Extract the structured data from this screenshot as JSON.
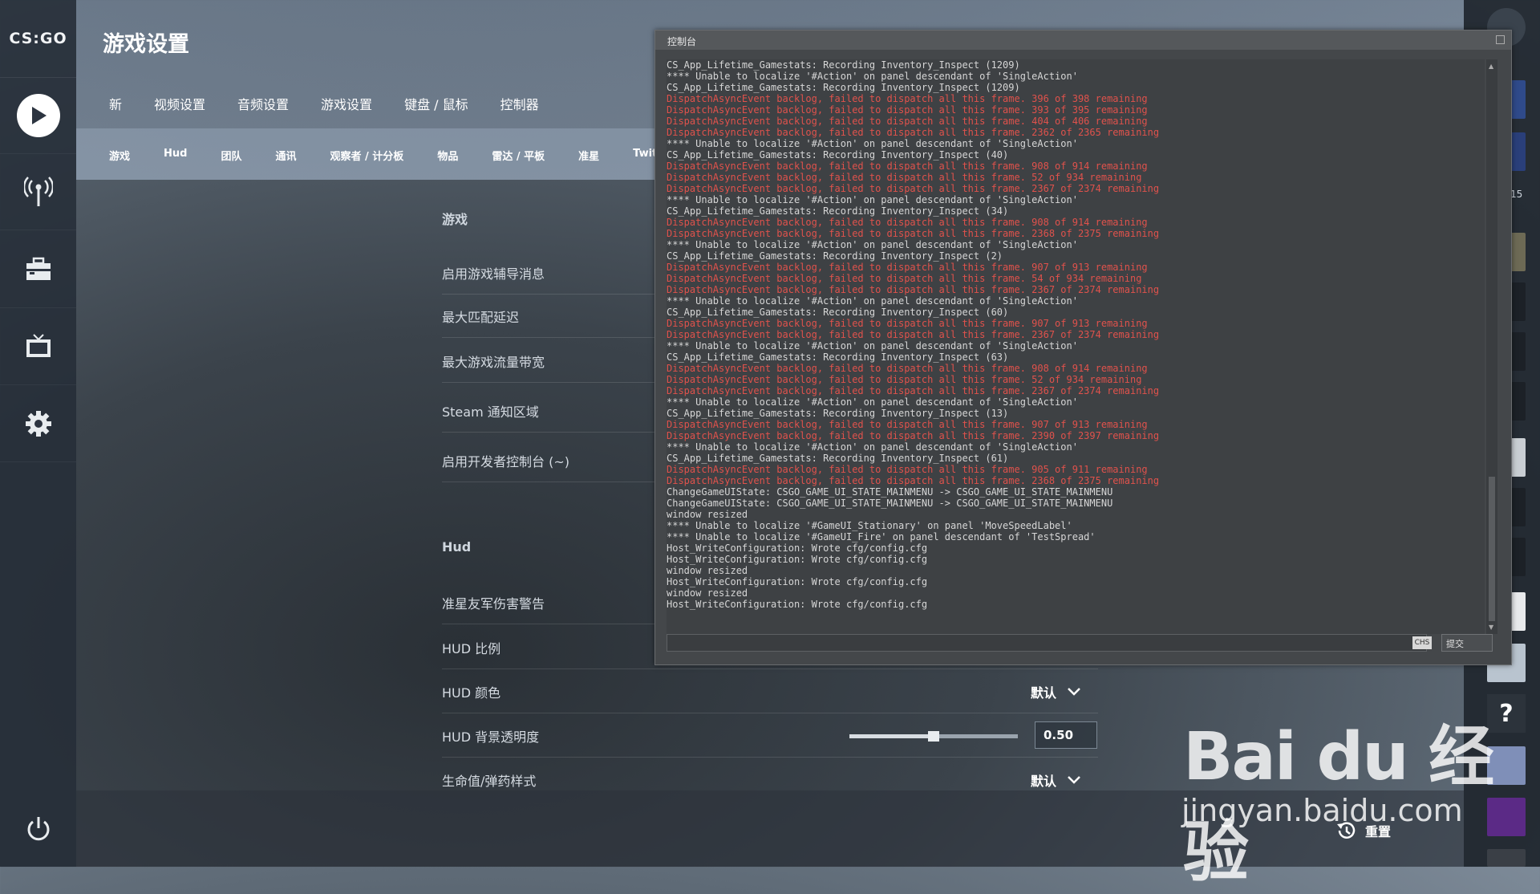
{
  "app": {
    "logo": "CS:GO",
    "title": "游戏设置"
  },
  "tabs": [
    "新",
    "视频设置",
    "音频设置",
    "游戏设置",
    "键盘 / 鼠标",
    "控制器"
  ],
  "subtabs": [
    "游戏",
    "Hud",
    "团队",
    "通讯",
    "观察者 / 计分板",
    "物品",
    "雷达 / 平板",
    "准星",
    "Twitch"
  ],
  "sections": {
    "game": {
      "title": "游戏",
      "rows": [
        "启用游戏辅导消息",
        "最大匹配延迟",
        "最大游戏流量带宽",
        "Steam 通知区域",
        "启用开发者控制台 (~)"
      ]
    },
    "hud": {
      "title": "Hud",
      "rows": {
        "ff_warning": "准星友军伤害警告",
        "hud_scale": "HUD 比例",
        "hud_color": "HUD 颜色",
        "hud_color_value": "默认",
        "hud_bg_alpha": "HUD 背景透明度",
        "hud_bg_alpha_value": "0.50",
        "hud_bg_alpha_fraction": 0.5,
        "health_style": "生命值/弹药样式",
        "health_style_value": "默认"
      }
    }
  },
  "console": {
    "title": "控制台",
    "ime": "CHS",
    "submit": "提交",
    "lines": [
      {
        "t": "CS_App_Lifetime_Gamestats: Recording Inventory_Inspect (1209)",
        "e": false
      },
      {
        "t": "**** Unable to localize '#Action' on panel descendant of 'SingleAction'",
        "e": false
      },
      {
        "t": "CS_App_Lifetime_Gamestats: Recording Inventory_Inspect (1209)",
        "e": false
      },
      {
        "t": "DispatchAsyncEvent backlog, failed to dispatch all this frame. 396 of 398 remaining",
        "e": true
      },
      {
        "t": "DispatchAsyncEvent backlog, failed to dispatch all this frame. 393 of 395 remaining",
        "e": true
      },
      {
        "t": "DispatchAsyncEvent backlog, failed to dispatch all this frame. 404 of 406 remaining",
        "e": true
      },
      {
        "t": "DispatchAsyncEvent backlog, failed to dispatch all this frame. 2362 of 2365 remaining",
        "e": true
      },
      {
        "t": "**** Unable to localize '#Action' on panel descendant of 'SingleAction'",
        "e": false
      },
      {
        "t": "CS_App_Lifetime_Gamestats: Recording Inventory_Inspect (40)",
        "e": false
      },
      {
        "t": "DispatchAsyncEvent backlog, failed to dispatch all this frame. 908 of 914 remaining",
        "e": true
      },
      {
        "t": "DispatchAsyncEvent backlog, failed to dispatch all this frame. 52 of 934 remaining",
        "e": true
      },
      {
        "t": "DispatchAsyncEvent backlog, failed to dispatch all this frame. 2367 of 2374 remaining",
        "e": true
      },
      {
        "t": "**** Unable to localize '#Action' on panel descendant of 'SingleAction'",
        "e": false
      },
      {
        "t": "CS_App_Lifetime_Gamestats: Recording Inventory_Inspect (34)",
        "e": false
      },
      {
        "t": "DispatchAsyncEvent backlog, failed to dispatch all this frame. 908 of 914 remaining",
        "e": true
      },
      {
        "t": "DispatchAsyncEvent backlog, failed to dispatch all this frame. 2368 of 2375 remaining",
        "e": true
      },
      {
        "t": "**** Unable to localize '#Action' on panel descendant of 'SingleAction'",
        "e": false
      },
      {
        "t": "CS_App_Lifetime_Gamestats: Recording Inventory_Inspect (2)",
        "e": false
      },
      {
        "t": "DispatchAsyncEvent backlog, failed to dispatch all this frame. 907 of 913 remaining",
        "e": true
      },
      {
        "t": "DispatchAsyncEvent backlog, failed to dispatch all this frame. 54 of 934 remaining",
        "e": true
      },
      {
        "t": "DispatchAsyncEvent backlog, failed to dispatch all this frame. 2367 of 2374 remaining",
        "e": true
      },
      {
        "t": "**** Unable to localize '#Action' on panel descendant of 'SingleAction'",
        "e": false
      },
      {
        "t": "CS_App_Lifetime_Gamestats: Recording Inventory_Inspect (60)",
        "e": false
      },
      {
        "t": "DispatchAsyncEvent backlog, failed to dispatch all this frame. 907 of 913 remaining",
        "e": true
      },
      {
        "t": "DispatchAsyncEvent backlog, failed to dispatch all this frame. 2367 of 2374 remaining",
        "e": true
      },
      {
        "t": "**** Unable to localize '#Action' on panel descendant of 'SingleAction'",
        "e": false
      },
      {
        "t": "CS_App_Lifetime_Gamestats: Recording Inventory_Inspect (63)",
        "e": false
      },
      {
        "t": "DispatchAsyncEvent backlog, failed to dispatch all this frame. 908 of 914 remaining",
        "e": true
      },
      {
        "t": "DispatchAsyncEvent backlog, failed to dispatch all this frame. 52 of 934 remaining",
        "e": true
      },
      {
        "t": "DispatchAsyncEvent backlog, failed to dispatch all this frame. 2367 of 2374 remaining",
        "e": true
      },
      {
        "t": "**** Unable to localize '#Action' on panel descendant of 'SingleAction'",
        "e": false
      },
      {
        "t": "CS_App_Lifetime_Gamestats: Recording Inventory_Inspect (13)",
        "e": false
      },
      {
        "t": "DispatchAsyncEvent backlog, failed to dispatch all this frame. 907 of 913 remaining",
        "e": true
      },
      {
        "t": "DispatchAsyncEvent backlog, failed to dispatch all this frame. 2390 of 2397 remaining",
        "e": true
      },
      {
        "t": "**** Unable to localize '#Action' on panel descendant of 'SingleAction'",
        "e": false
      },
      {
        "t": "CS_App_Lifetime_Gamestats: Recording Inventory_Inspect (61)",
        "e": false
      },
      {
        "t": "DispatchAsyncEvent backlog, failed to dispatch all this frame. 905 of 911 remaining",
        "e": true
      },
      {
        "t": "DispatchAsyncEvent backlog, failed to dispatch all this frame. 2368 of 2375 remaining",
        "e": true
      },
      {
        "t": "ChangeGameUIState: CSGO_GAME_UI_STATE_MAINMENU -> CSGO_GAME_UI_STATE_MAINMENU",
        "e": false
      },
      {
        "t": "ChangeGameUIState: CSGO_GAME_UI_STATE_MAINMENU -> CSGO_GAME_UI_STATE_MAINMENU",
        "e": false
      },
      {
        "t": "window resized",
        "e": false
      },
      {
        "t": "**** Unable to localize '#GameUI_Stationary' on panel 'MoveSpeedLabel'",
        "e": false
      },
      {
        "t": "**** Unable to localize '#GameUI_Fire' on panel descendant of 'TestSpread'",
        "e": false
      },
      {
        "t": "Host_WriteConfiguration: Wrote cfg/config.cfg",
        "e": false
      },
      {
        "t": "Host_WriteConfiguration: Wrote cfg/config.cfg",
        "e": false
      },
      {
        "t": "window resized",
        "e": false
      },
      {
        "t": "Host_WriteConfiguration: Wrote cfg/config.cfg",
        "e": false
      },
      {
        "t": "window resized",
        "e": false
      },
      {
        "t": "Host_WriteConfiguration: Wrote cfg/config.cfg",
        "e": false
      }
    ]
  },
  "rightbar": {
    "count": "15",
    "help": "?"
  },
  "bottom": {
    "reset": "重置"
  },
  "watermark": {
    "brand": "Bai du 经验",
    "url": "jingyan.baidu.com"
  },
  "icons": {
    "play": "play-icon",
    "broadcast": "broadcast-icon",
    "inventory": "briefcase-icon",
    "watch": "tv-icon",
    "settings": "gear-icon",
    "power": "power-icon",
    "reset": "history-icon",
    "chevron": "chevron-down-icon"
  },
  "colors": {
    "error_text": "#e0524c",
    "log_text": "#d6d6d6"
  }
}
